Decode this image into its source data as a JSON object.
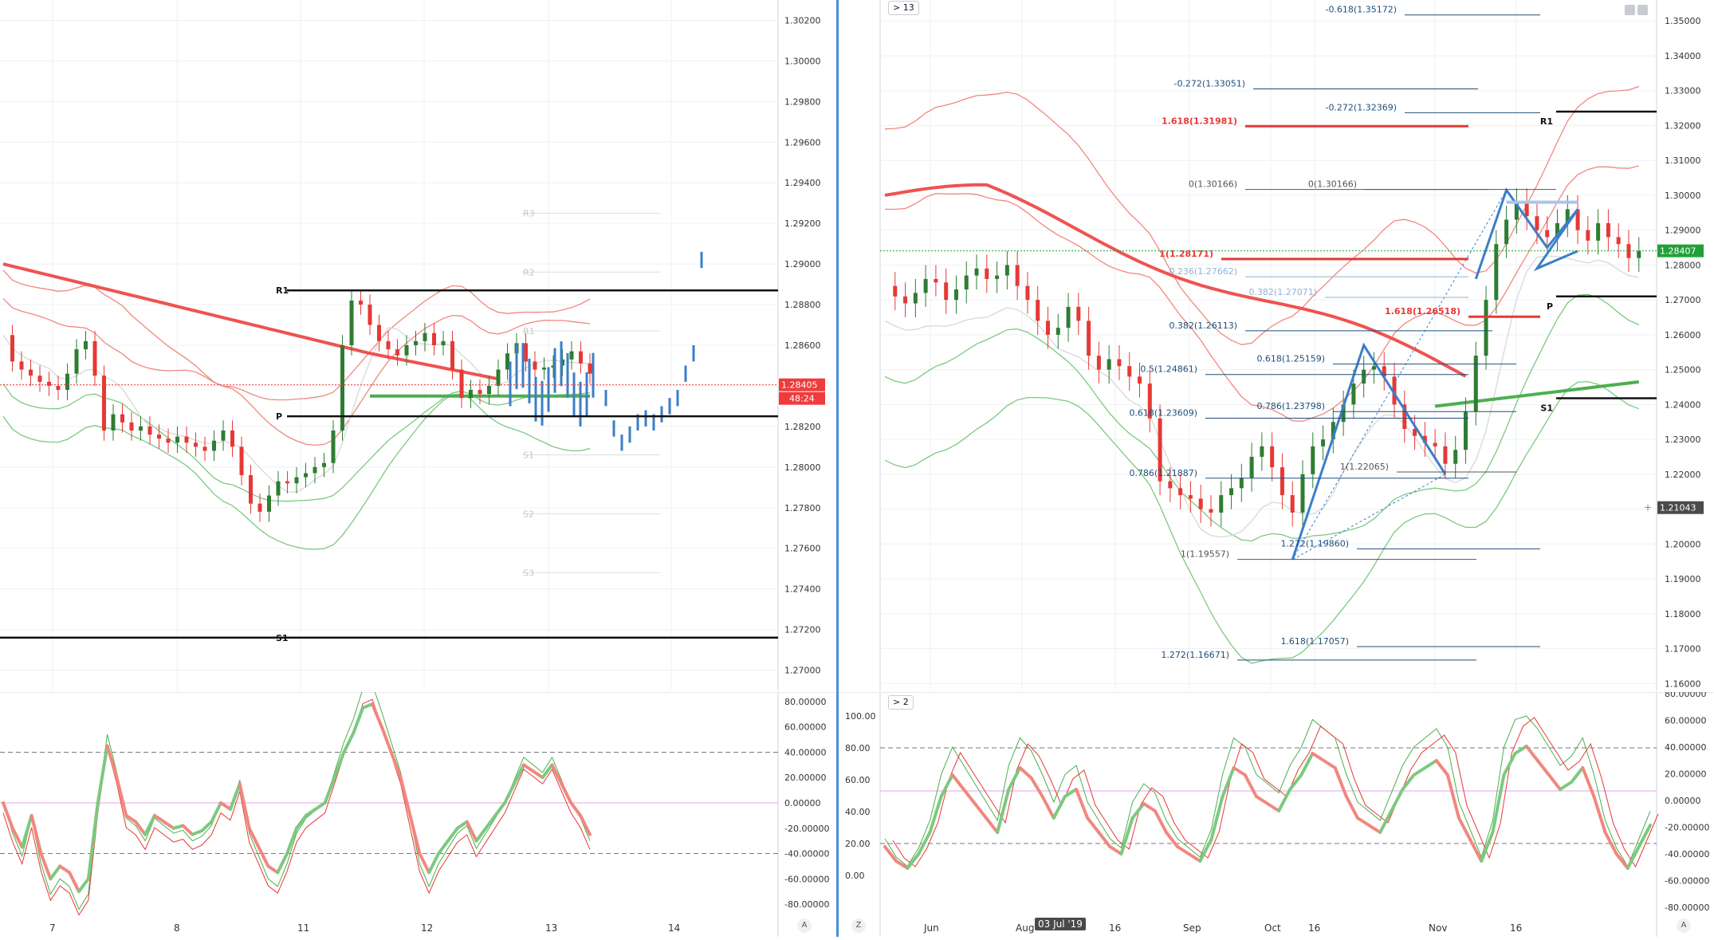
{
  "layout_labels": {
    "left_btn_a": "A",
    "right_btn_z": "Z",
    "right_btn_a": "A",
    "right_collapse_top": "> 13",
    "right_collapse_bottom": "> 2",
    "cursor_date": "03 Jul '19"
  },
  "colors": {
    "bull_candle": "#2e7d32",
    "bear_candle": "#e53935",
    "fib_blue": "#1f4e79",
    "fib_red": "#e53935",
    "bollinger_upper": "#f1877f",
    "bollinger_lower": "#7cc97f",
    "ma_red": "#ef5350",
    "ma_green": "#4caf50",
    "pattern_blue": "#3b7ec9",
    "price_tag_red": "#ef3b3b",
    "price_tag_green": "#22a038"
  },
  "chart_data": [
    {
      "type": "line",
      "name_hint": "left-price-pane",
      "x_tick_labels": [
        "7",
        "8",
        "11",
        "12",
        "13",
        "14"
      ],
      "y_tick_labels": [
        "1.30200",
        "1.30000",
        "1.29800",
        "1.29600",
        "1.29400",
        "1.29200",
        "1.29000",
        "1.28800",
        "1.28600",
        "1.28400",
        "1.28200",
        "1.28000",
        "1.27800",
        "1.27600",
        "1.27400",
        "1.27200",
        "1.27000"
      ],
      "ylim": [
        1.269,
        1.303
      ],
      "current_price": "1.28405",
      "countdown": "48:24",
      "pivot_levels": [
        {
          "label": "R1",
          "value": 1.2887
        },
        {
          "label": "P",
          "value": 1.2825
        },
        {
          "label": "S1",
          "value": 1.2716
        }
      ],
      "faint_pivots": [
        "R3",
        "R2",
        "R1",
        "S1",
        "S2",
        "S3"
      ],
      "series_close": [
        1.2865,
        1.2852,
        1.2848,
        1.2845,
        1.2842,
        1.284,
        1.2838,
        1.2846,
        1.2858,
        1.2862,
        1.2845,
        1.2818,
        1.2826,
        1.2822,
        1.2818,
        1.282,
        1.2816,
        1.2814,
        1.2812,
        1.2815,
        1.2812,
        1.281,
        1.2808,
        1.2813,
        1.2818,
        1.281,
        1.2796,
        1.2782,
        1.2778,
        1.2786,
        1.2793,
        1.2792,
        1.2795,
        1.2797,
        1.28,
        1.2802,
        1.2818,
        1.286,
        1.2882,
        1.288,
        1.287,
        1.2862,
        1.2858,
        1.2855,
        1.286,
        1.2862,
        1.2866,
        1.286,
        1.2862,
        1.2848,
        1.2834,
        1.2838,
        1.2836,
        1.284,
        1.2848,
        1.2856,
        1.2861,
        1.2852,
        1.2848,
        1.2849,
        1.285,
        1.2853,
        1.2857,
        1.2851,
        1.2846
      ],
      "projection_bars": [
        1.283,
        1.2815,
        1.2808,
        1.2812,
        1.2818,
        1.282,
        1.2818,
        1.2822,
        1.2826,
        1.283,
        1.2842,
        1.2852,
        1.2898
      ]
    },
    {
      "type": "line",
      "name_hint": "left-oscillator-pane",
      "y_tick_labels": [
        "80.00000",
        "60.00000",
        "40.00000",
        "20.00000",
        "0.00000",
        "-20.00000",
        "-40.00000",
        "-60.00000",
        "-80.00000"
      ],
      "ylim": [
        -85,
        85
      ],
      "levels": [
        40,
        -40
      ],
      "series": [
        {
          "name": "",
          "values": [
            0,
            -20,
            -35,
            -10,
            -40,
            -60,
            -50,
            -55,
            -70,
            -60,
            0,
            45,
            20,
            -10,
            -15,
            -25,
            -10,
            -15,
            -20,
            -18,
            -25,
            -22,
            -15,
            0,
            -5,
            15,
            -20,
            -35,
            -50,
            -55,
            -40,
            -20,
            -10,
            -5,
            0,
            20,
            40,
            55,
            75,
            78,
            60,
            40,
            20,
            -10,
            -40,
            -55,
            -40,
            -30,
            -20,
            -15,
            -30,
            -20,
            -10,
            0,
            15,
            30,
            25,
            20,
            30,
            15,
            0,
            -10,
            -25
          ]
        }
      ]
    },
    {
      "type": "line",
      "name_hint": "right-price-pane",
      "x_tick_labels": [
        "Jun",
        "Aug",
        "16",
        "Sep",
        "Oct",
        "16",
        "Nov",
        "16"
      ],
      "y_tick_labels": [
        "1.35000",
        "1.34000",
        "1.33000",
        "1.32000",
        "1.31000",
        "1.30000",
        "1.29000",
        "1.28000",
        "1.27000",
        "1.26000",
        "1.25000",
        "1.24000",
        "1.23000",
        "1.22000",
        "1.21000",
        "1.20000",
        "1.19000",
        "1.18000",
        "1.17000",
        "1.16000"
      ],
      "ylim": [
        1.158,
        1.356
      ],
      "current_price": "1.28407",
      "cursor_price": "1.21043",
      "pivot_levels": [
        {
          "label": "R1",
          "value": 1.324
        },
        {
          "label": "P",
          "value": 1.271
        },
        {
          "label": "S1",
          "value": 1.2418
        }
      ],
      "fib_labels": [
        {
          "text": "-0.618(1.35172)",
          "value": 1.35172,
          "color": "blue"
        },
        {
          "text": "-0.272(1.33051)",
          "value": 1.33051,
          "color": "blue"
        },
        {
          "text": "-0.272(1.32369)",
          "value": 1.32369,
          "color": "blue"
        },
        {
          "text": "1.618(1.31981)",
          "value": 1.31981,
          "color": "red"
        },
        {
          "text": "0(1.30166)",
          "value": 1.30166,
          "color": "gray"
        },
        {
          "text": "0(1.30166)",
          "value": 1.30166,
          "color": "gray"
        },
        {
          "text": "1(1.28171)",
          "value": 1.28171,
          "color": "red"
        },
        {
          "text": "0.236(1.27662)",
          "value": 1.27662,
          "color": "lightblue"
        },
        {
          "text": "0.382(1.27071)",
          "value": 1.27071,
          "color": "lightblue"
        },
        {
          "text": "0.382(1.26113)",
          "value": 1.26113,
          "color": "blue"
        },
        {
          "text": "1.618(1.26518)",
          "value": 1.26518,
          "color": "red"
        },
        {
          "text": "0.618(1.25159)",
          "value": 1.25159,
          "color": "blue"
        },
        {
          "text": "0.5(1.24861)",
          "value": 1.24861,
          "color": "blue"
        },
        {
          "text": "0.618(1.23609)",
          "value": 1.23609,
          "color": "blue"
        },
        {
          "text": "0.786(1.23798)",
          "value": 1.23798,
          "color": "blue"
        },
        {
          "text": "1(1.22065)",
          "value": 1.22065,
          "color": "gray"
        },
        {
          "text": "0.786(1.21887)",
          "value": 1.21887,
          "color": "blue"
        },
        {
          "text": "1.272(1.19860)",
          "value": 1.1986,
          "color": "blue"
        },
        {
          "text": "1(1.19557)",
          "value": 1.19557,
          "color": "gray"
        },
        {
          "text": "1.618(1.17057)",
          "value": 1.17057,
          "color": "blue"
        },
        {
          "text": "1.272(1.16671)",
          "value": 1.16671,
          "color": "blue"
        }
      ],
      "series_close": [
        1.274,
        1.271,
        1.269,
        1.272,
        1.276,
        1.275,
        1.27,
        1.273,
        1.277,
        1.279,
        1.276,
        1.277,
        1.28,
        1.274,
        1.27,
        1.264,
        1.26,
        1.262,
        1.268,
        1.264,
        1.254,
        1.25,
        1.253,
        1.251,
        1.248,
        1.246,
        1.236,
        1.218,
        1.216,
        1.214,
        1.213,
        1.21,
        1.209,
        1.214,
        1.216,
        1.219,
        1.225,
        1.228,
        1.222,
        1.214,
        1.209,
        1.22,
        1.228,
        1.23,
        1.235,
        1.24,
        1.246,
        1.25,
        1.251,
        1.248,
        1.24,
        1.233,
        1.231,
        1.229,
        1.228,
        1.223,
        1.227,
        1.238,
        1.254,
        1.27,
        1.286,
        1.293,
        1.298,
        1.294,
        1.29,
        1.288,
        1.292,
        1.296,
        1.29,
        1.287,
        1.292,
        1.288,
        1.286,
        1.282,
        1.284
      ]
    },
    {
      "type": "line",
      "name_hint": "right-oscillator-pane",
      "y_tick_labels_left": [
        "100.00",
        "80.00",
        "60.00",
        "40.00",
        "20.00",
        "0.00"
      ],
      "y_tick_labels_right": [
        "80.00000",
        "60.00000",
        "40.00000",
        "20.00000",
        "0.00000",
        "-20.00000",
        "-40.00000",
        "-60.00000",
        "-80.00000"
      ],
      "ylim": [
        -5,
        105
      ],
      "levels": [
        80,
        20
      ],
      "series": [
        {
          "name": "",
          "values": [
            20,
            10,
            5,
            15,
            30,
            55,
            70,
            60,
            50,
            40,
            30,
            60,
            75,
            68,
            55,
            40,
            55,
            60,
            40,
            30,
            20,
            15,
            40,
            50,
            45,
            30,
            20,
            15,
            10,
            25,
            55,
            75,
            70,
            55,
            50,
            45,
            60,
            70,
            85,
            80,
            75,
            55,
            40,
            35,
            30,
            45,
            60,
            70,
            75,
            80,
            70,
            40,
            25,
            10,
            30,
            70,
            85,
            90,
            80,
            70,
            60,
            65,
            75,
            55,
            30,
            15,
            5,
            20,
            35
          ]
        }
      ]
    }
  ]
}
